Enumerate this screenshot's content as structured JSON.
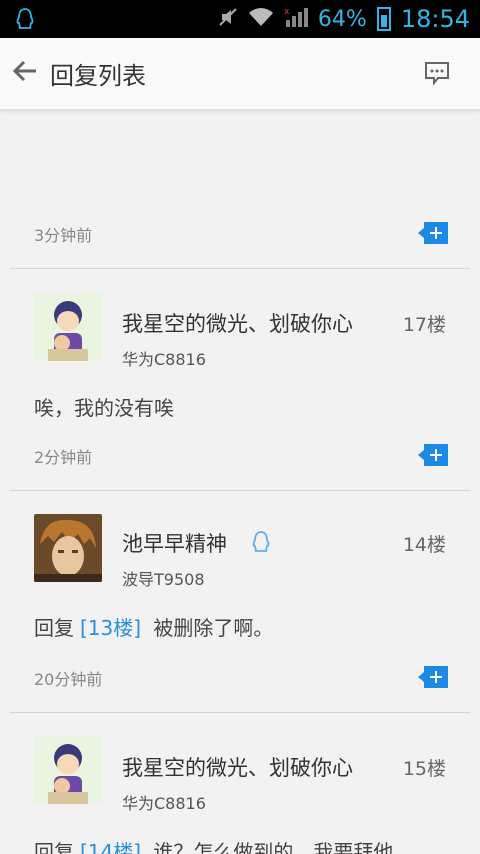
{
  "status_bar": {
    "battery": "64%",
    "time": "18:54"
  },
  "appbar": {
    "title": "回复列表"
  },
  "first_meta": {
    "time": "3分钟前"
  },
  "posts": [
    {
      "username": "我星空的微光、划破你心",
      "device": "华为C8816",
      "floor": "17楼",
      "message": "唉，我的没有唉",
      "time": "2分钟前"
    },
    {
      "username": "池早早精神",
      "device": "波导T9508",
      "floor": "14楼",
      "reply_label": "回复",
      "reply_ref": "[13楼]",
      "message": "被删除了啊。",
      "time": "20分钟前"
    },
    {
      "username": "我星空的微光、划破你心",
      "device": "华为C8816",
      "floor": "15楼",
      "reply_label": "回复",
      "reply_ref": "[14楼]",
      "message": "谁？怎么做到的，我要拜他"
    }
  ],
  "colors": {
    "accent": "#1e88e5",
    "link": "#2a8fd6",
    "status_icon": "#33b5e5"
  }
}
